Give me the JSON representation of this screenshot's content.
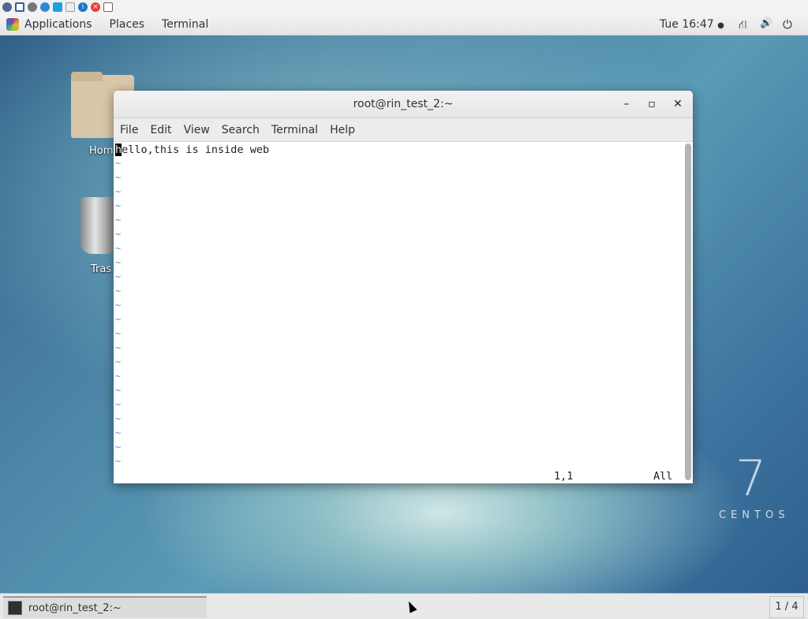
{
  "vm_toolbar": {
    "icons": [
      "vm-settings-icon",
      "fullscreen-icon",
      "gear-icon",
      "refresh-icon",
      "windows-icon",
      "keyboard-icon",
      "info-icon",
      "close-red-icon",
      "disconnect-icon"
    ]
  },
  "topbar": {
    "applications": "Applications",
    "places": "Places",
    "terminal": "Terminal",
    "clock": "Tue 16:47",
    "clock_dot": "●",
    "network_icon": "⛙",
    "volume_icon": "🔊",
    "power_icon": "⏻"
  },
  "desktop": {
    "home_label": "Hom",
    "trash_label": "Tras",
    "logo_number": "7",
    "logo_text": "CENTOS"
  },
  "window": {
    "title": "root@rin_test_2:~",
    "minimize": "–",
    "maximize": "▫",
    "close": "✕",
    "menu": [
      "File",
      "Edit",
      "View",
      "Search",
      "Terminal",
      "Help"
    ],
    "cursor_char": "h",
    "line1_rest": "ello,this is inside web",
    "tilde": "~",
    "tilde_count": 22,
    "position": "1,1",
    "scroll_pos": "All"
  },
  "taskbar": {
    "task_label": "root@rin_test_2:~",
    "workspace": "1 / 4"
  }
}
